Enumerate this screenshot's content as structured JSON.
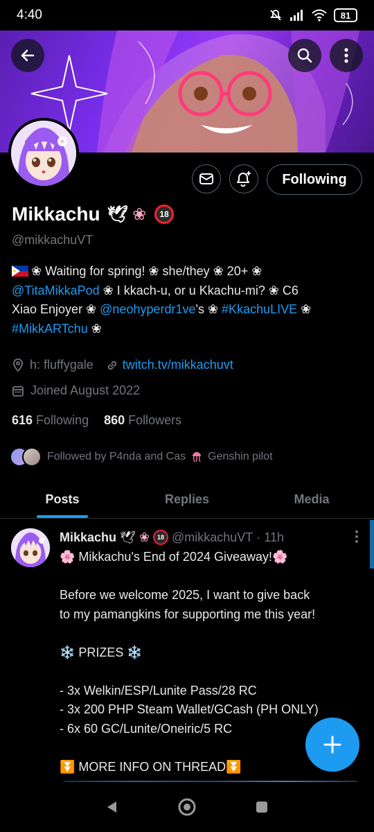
{
  "status_bar": {
    "time": "4:40",
    "battery": "81"
  },
  "profile": {
    "display_name": "Mikkachu",
    "handle": "@mikkachuVT",
    "badge_age": "18",
    "following_button": "Following",
    "bio": {
      "line1": "❀ Waiting for spring! ❀ she/they ❀ 20+ ❀",
      "mention1": "@TitaMikkaPod",
      "line2_rest": " ❀ I kkach-u, or u Kkachu-mi? ❀ C6",
      "line3_start": "Xiao Enjoyer ❀ ",
      "mention2": "@neohyperdr1ve",
      "line3_mid": "'s ❀ ",
      "hashtag1": "#KkachuLIVE",
      "line3_end": " ❀",
      "hashtag2": "#MikkARTchu",
      "line4_end": " ❀"
    },
    "location": "h: fluffygale",
    "website": "twitch.tv/mikkachuvt",
    "joined": "Joined August 2022",
    "following_count": "616",
    "following_label": "Following",
    "followers_count": "860",
    "followers_label": "Followers",
    "followed_by": "Followed by P4nda and Cas",
    "followed_by_tail": "Genshin pilot"
  },
  "tabs": [
    "Posts",
    "Replies",
    "Media"
  ],
  "tweet": {
    "name": "Mikkachu",
    "handle": "@mikkachuVT",
    "time": "· 11h",
    "lines": [
      "🌸 Mikkachu's End of 2024 Giveaway!🌸",
      "",
      "Before we welcome 2025, I want to give back",
      "to my pamangkins for supporting me this year!",
      "",
      "❄️ PRIZES ❄️",
      "",
      "- 3x Welkin/ESP/Lunite Pass/28 RC",
      "- 3x 200 PHP Steam Wallet/GCash (PH ONLY)",
      "- 6x 60 GC/Lunite/Oneiric/5 RC",
      "",
      "⏬ MORE INFO ON THREAD⏬"
    ]
  },
  "colors": {
    "accent": "#1d9bf0",
    "muted": "#71767b",
    "text": "#e7e9ea",
    "background": "#000000"
  }
}
